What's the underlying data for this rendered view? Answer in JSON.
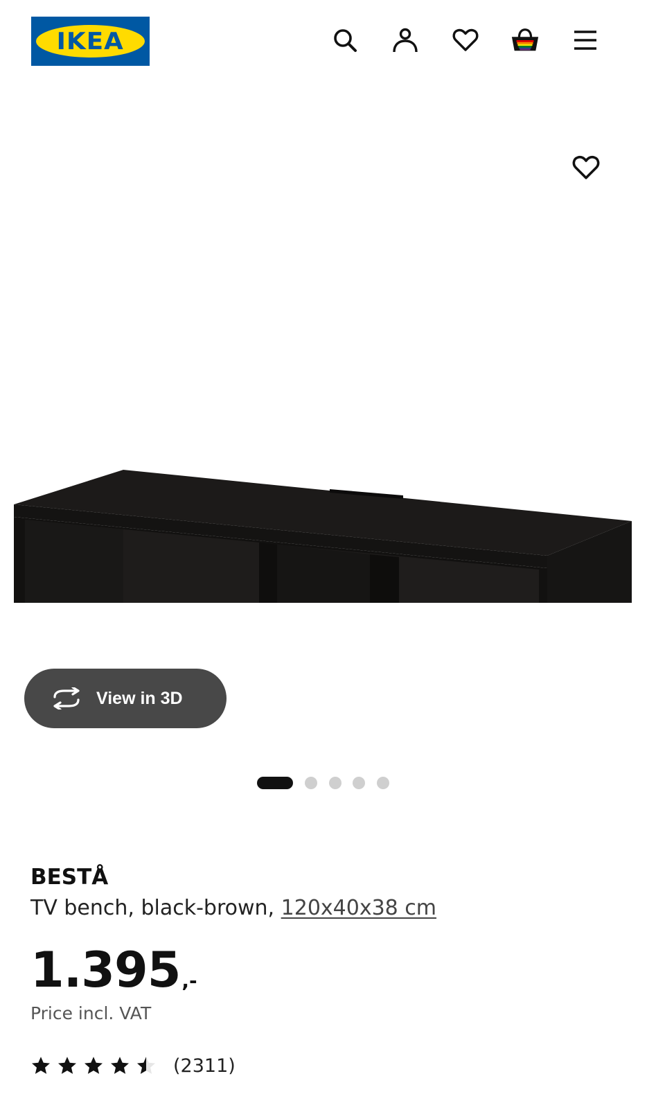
{
  "header": {
    "logo_text": "IKEA",
    "logo_mark": "®",
    "icons": [
      "search-icon",
      "account-icon",
      "favourites-icon",
      "shopping-bag-icon",
      "menu-icon"
    ]
  },
  "gallery": {
    "view_3d_label": "View in 3D",
    "image_count": 5,
    "active_index": 0
  },
  "product": {
    "brand": "BESTÅ",
    "description": "TV bench, black-brown, ",
    "dimensions_link": "120x40x38 cm",
    "price": "1.395",
    "price_suffix": ",-",
    "price_note": "Price incl. VAT",
    "rating_value": 4.5,
    "rating_max": 5,
    "review_count": "(2311)"
  },
  "colors": {
    "ikea_blue": "#0058a3",
    "ikea_yellow": "#ffdb00",
    "button_dark": "#484848",
    "dot_inactive": "#cfcfcf"
  }
}
